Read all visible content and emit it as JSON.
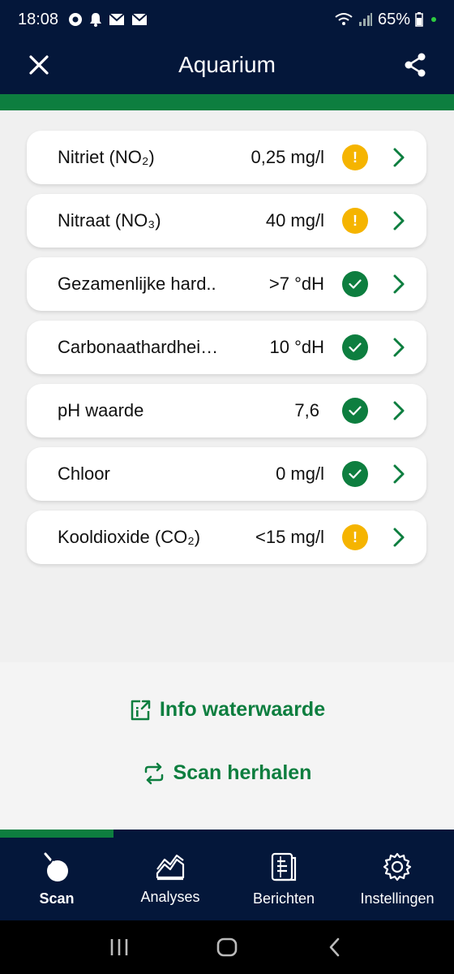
{
  "status_bar": {
    "time": "18:08",
    "battery": "65%"
  },
  "app_bar": {
    "title": "Aquarium"
  },
  "rows": [
    {
      "label": "Nitriet (NO₂)",
      "value": "0,25 mg/l",
      "status": "warning"
    },
    {
      "label": "Nitraat (NO₃)",
      "value": "40 mg/l",
      "status": "warning"
    },
    {
      "label": "Gezamenlijke hard..",
      "value": ">7 °dH",
      "status": "ok"
    },
    {
      "label": "Carbonaathardhei…",
      "value": "10 °dH",
      "status": "ok"
    },
    {
      "label": "pH waarde",
      "value": "7,6",
      "status": "ok"
    },
    {
      "label": "Chloor",
      "value": "0 mg/l",
      "status": "ok"
    },
    {
      "label": "Kooldioxide (CO₂)",
      "value": "<15 mg/l",
      "status": "warning"
    }
  ],
  "actions": {
    "info_label": "Info waterwaarde",
    "rescan_label": "Scan herhalen"
  },
  "progress": {
    "fraction": 0.25
  },
  "bottom_nav": [
    {
      "label": "Scan",
      "icon": "scan-icon",
      "active": true
    },
    {
      "label": "Analyses",
      "icon": "chart-icon",
      "active": false
    },
    {
      "label": "Berichten",
      "icon": "document-icon",
      "active": false
    },
    {
      "label": "Instellingen",
      "icon": "gear-icon",
      "active": false
    }
  ],
  "colors": {
    "navy": "#04173a",
    "green": "#0d7e3f",
    "warning": "#f5b400"
  }
}
